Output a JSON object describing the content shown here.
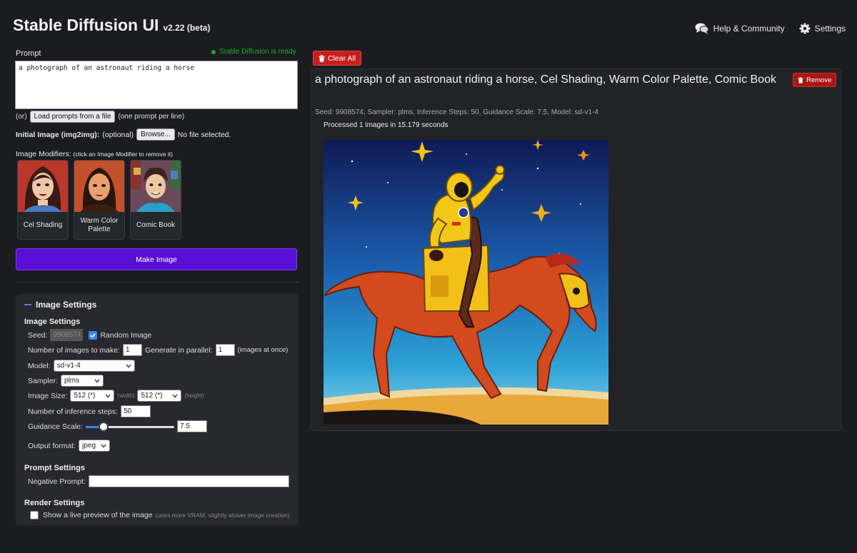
{
  "header": {
    "title": "Stable Diffusion UI",
    "version": "v2.22 (beta)",
    "help_label": "Help & Community",
    "settings_label": "Settings"
  },
  "prompt": {
    "label": "Prompt",
    "status": "Stable Diffusion is ready",
    "status_color": "#18a82b",
    "value": "a photograph of an astronaut riding a horse",
    "or_text": "(or)",
    "load_button": "Load prompts from a file",
    "load_hint": "(one prompt per line)"
  },
  "init_image": {
    "label": "Initial Image (img2img):",
    "optional": "(optional)",
    "browse_button": "Browse...",
    "file_status": "No file selected."
  },
  "modifiers": {
    "label": "Image Modifiers:",
    "hint": "(click an Image Modifier to remove it)",
    "items": [
      {
        "label": "Cel Shading"
      },
      {
        "label": "Warm Color Palette"
      },
      {
        "label": "Comic Book"
      }
    ]
  },
  "make_image_button": "Make Image",
  "accent_color": "#5a0fd6",
  "settings": {
    "panel_title": "Image Settings",
    "image_section": "Image Settings",
    "seed_label": "Seed:",
    "seed_value": "9908574",
    "random_image_label": "Random Image",
    "random_image_checked": true,
    "num_images_label": "Number of images to make:",
    "num_images_value": "1",
    "parallel_label": "Generate in parallel:",
    "parallel_value": "1",
    "parallel_hint": "(images at once)",
    "model_label": "Model:",
    "model_value": "sd-v1-4",
    "sampler_label": "Sampler:",
    "sampler_value": "plms",
    "image_size_label": "Image Size:",
    "width_value": "512 (*)",
    "width_hint": "(width)",
    "height_value": "512 (*)",
    "height_hint": "(height)",
    "steps_label": "Number of inference steps:",
    "steps_value": "50",
    "guidance_label": "Guidance Scale:",
    "guidance_value": "7.5",
    "guidance_slider_fraction": 0.16,
    "output_label": "Output format:",
    "output_value": "jpeg",
    "prompt_section": "Prompt Settings",
    "negative_label": "Negative Prompt:",
    "negative_value": "",
    "render_section": "Render Settings",
    "live_preview_label": "Show a live preview of the image",
    "live_preview_hint": "(uses more VRAM, slightly slower image creation)",
    "live_preview_checked": false
  },
  "results": {
    "clear_all_button": "Clear All",
    "title": "a photograph of an astronaut riding a horse, Cel Shading, Warm Color Palette, Comic Book",
    "remove_button": "Remove",
    "meta": "Seed: 9908574, Sampler: plms, Inference Steps: 50, Guidance Scale: 7.5, Model: sd-v1-4",
    "processed": "Processed 1 images in 15.179 seconds",
    "danger_color": "#c81e1e"
  }
}
